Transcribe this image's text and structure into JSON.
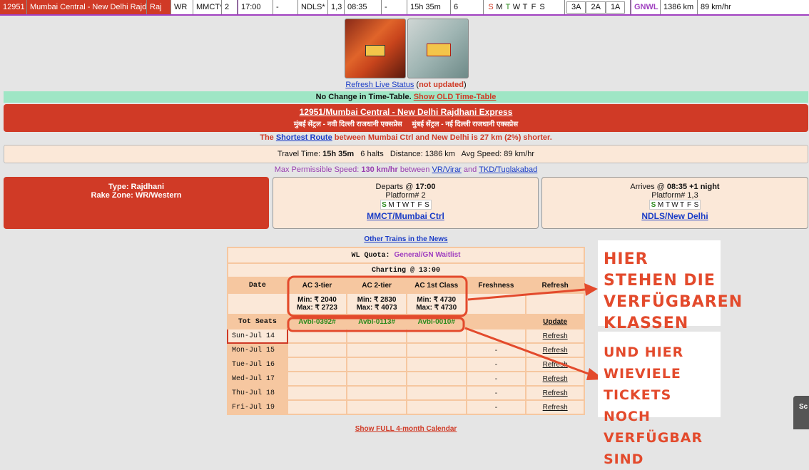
{
  "topbar": {
    "number": "12951",
    "name": "Mumbai Central - New Delhi Rajdh...",
    "type": "Raj",
    "zone": "WR",
    "from": "MMCT*",
    "from_pf": "2",
    "dep": "17:00",
    "dash1": "-",
    "to": "NDLS*",
    "to_pf": "1,3",
    "arr": "08:35",
    "dash2": "-",
    "duration": "15h 35m",
    "halts": "6",
    "days": [
      "S",
      "M",
      "T",
      "W",
      "T",
      "F",
      "S"
    ],
    "classes": [
      "3A",
      "2A",
      "1A"
    ],
    "quota": "GNWL",
    "distance": "1386 km",
    "speed": "89 km/hr"
  },
  "live": {
    "refresh": "Refresh Live Status",
    "open_paren": "(",
    "not_updated": "not updated",
    "close_paren": ")"
  },
  "timetable": {
    "text": "No Change in Time-Table.",
    "link": "Show OLD Time-Table"
  },
  "title": {
    "main": "12951/Mumbai Central - New Delhi Rajdhani Express",
    "hindi": "मुंबई सेंट्रल - नवी दिल्ली राजधानी एक्सप्रेस     मुंबई सेंट्रल - नई दिल्ली राजधानी एक्सप्रेस"
  },
  "route": {
    "prefix": "The",
    "link": "Shortest Route",
    "suffix": "between Mumbai Ctrl and New Delhi is 27 km (2%) shorter."
  },
  "travel": {
    "label": "Travel Time:",
    "time": "15h 35m",
    "halts": "6 halts",
    "distance": "Distance: 1386 km",
    "speed": "Avg Speed: 89 km/hr"
  },
  "maxspeed": {
    "prefix": "Max Permissible Speed:",
    "value": "130 km/hr",
    "between": "between",
    "from": "VR/Virar",
    "and": "and",
    "to": "TKD/Tuglakabad"
  },
  "typebox": {
    "type": "Type: Rajdhani",
    "rake": "Rake Zone: WR/Western"
  },
  "departs": {
    "label": "Departs @",
    "time": "17:00",
    "platform": "Platform# 2",
    "days": [
      "S",
      "M",
      "T",
      "W",
      "T",
      "F",
      "S"
    ],
    "station": "MMCT/Mumbai Ctrl"
  },
  "arrives": {
    "label": "Arrives @",
    "time": "08:35 +1 night",
    "platform": "Platform# 1,3",
    "days": [
      "S",
      "M",
      "T",
      "W",
      "T",
      "F",
      "S"
    ],
    "station": "NDLS/New Delhi"
  },
  "news": "Other Trains in the News",
  "wl": {
    "quota_label": "WL Quota:",
    "quota_value": "General/GN Waitlist",
    "charting": "Charting @ 13:00",
    "headers": [
      "Date",
      "AC 3-tier",
      "AC 2-tier",
      "AC 1st Class",
      "Freshness",
      "Refresh"
    ],
    "fares": [
      {
        "min": "Min: ₹ 2040",
        "max": "Max: ₹ 2723"
      },
      {
        "min": "Min: ₹ 2830",
        "max": "Max: ₹ 4073"
      },
      {
        "min": "Min: ₹ 4730",
        "max": "Max: ₹ 4730"
      }
    ],
    "tot_seats": "Tot Seats",
    "avail": [
      "Avbl-0392#",
      "Avbl-0113#",
      "Avbl-0010#"
    ],
    "update": "Update",
    "rows": [
      {
        "date": "Sun-Jul 14",
        "fresh": "",
        "refresh": "Refresh"
      },
      {
        "date": "Mon-Jul 15",
        "fresh": "-",
        "refresh": "Refresh"
      },
      {
        "date": "Tue-Jul 16",
        "fresh": "-",
        "refresh": "Refresh"
      },
      {
        "date": "Wed-Jul 17",
        "fresh": "-",
        "refresh": "Refresh"
      },
      {
        "date": "Thu-Jul 18",
        "fresh": "-",
        "refresh": "Refresh"
      },
      {
        "date": "Fri-Jul 19",
        "fresh": "-",
        "refresh": "Refresh"
      }
    ],
    "calendar": "Show FULL 4-month Calendar"
  },
  "annotations": {
    "box1": [
      "HIER STEHEN DIE",
      "VERFÜGBAREN",
      "KLASSEN"
    ],
    "box2": [
      "UND HIER WIEVIELE",
      "TICKETS NOCH",
      "VERFÜGBAR SIND"
    ]
  },
  "scroll_label": "Sc",
  "colors": {
    "red": "#d03a26",
    "green_bar": "#9fe6c5",
    "peach": "#fbe8d8",
    "table": "#f6c7a0",
    "annotation": "#e34a2c",
    "link": "#1a3cc7"
  }
}
